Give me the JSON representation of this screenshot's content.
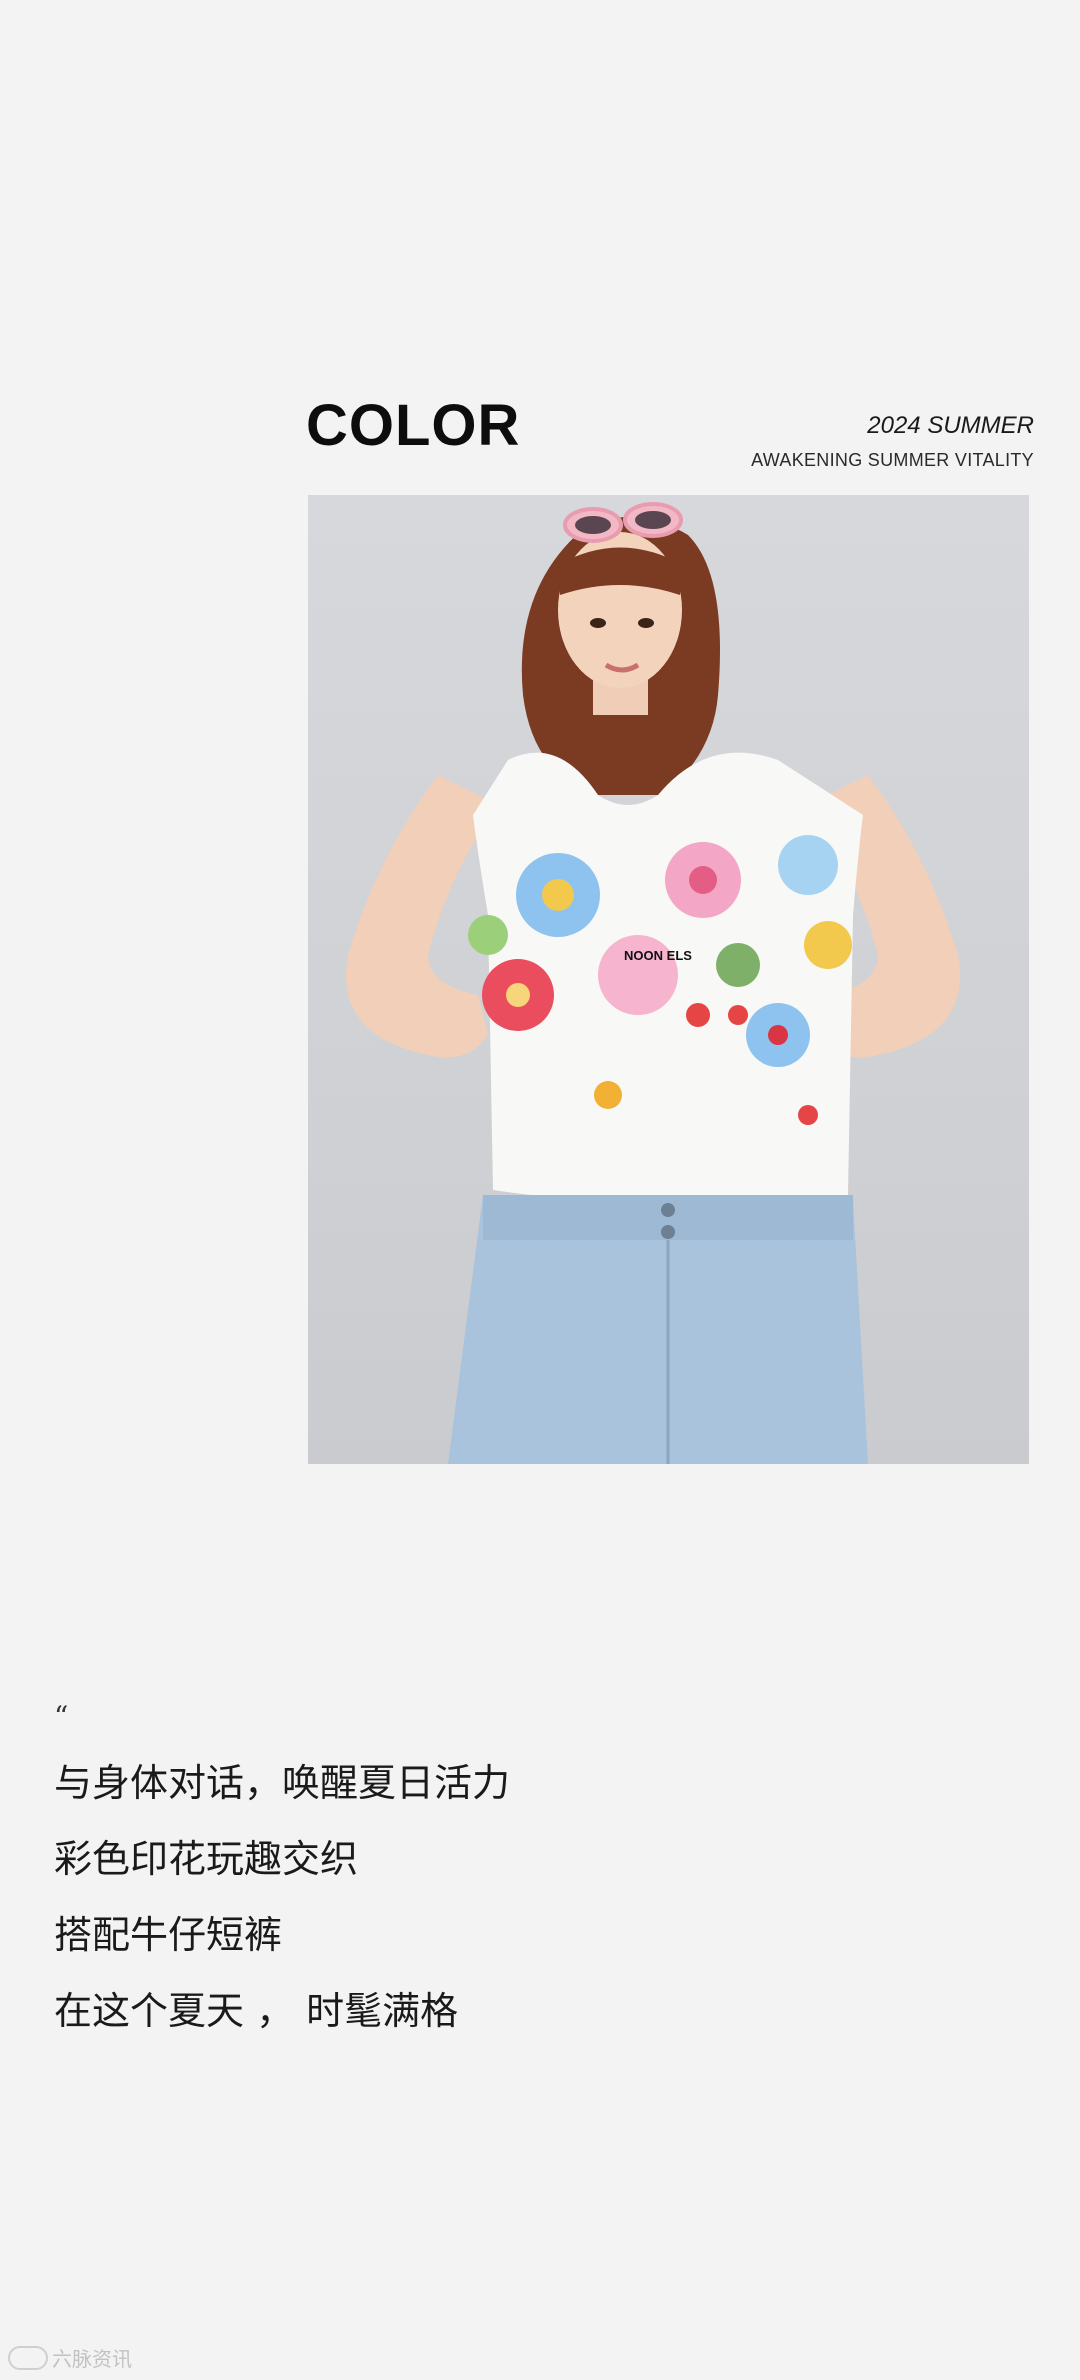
{
  "header": {
    "title": "COLOR",
    "season": "2024 SUMMER",
    "tagline": "AWAKENING SUMMER VITALITY"
  },
  "product_photo": {
    "graphic_text": "NOON ELS"
  },
  "caption": {
    "quote_mark": "“",
    "lines": [
      "与身体对话，唤醒夏日活力",
      "彩色印花玩趣交织",
      "搭配牛仔短裤",
      "在这个夏天 ， 时髦满格"
    ]
  },
  "watermark": {
    "text": "六脉资讯"
  },
  "colors": {
    "background": "#f3f3f3",
    "photo_background": "#d3d5d9",
    "text": "#111111",
    "denim": "#a9c3dc",
    "top": "#f8f8f6"
  }
}
